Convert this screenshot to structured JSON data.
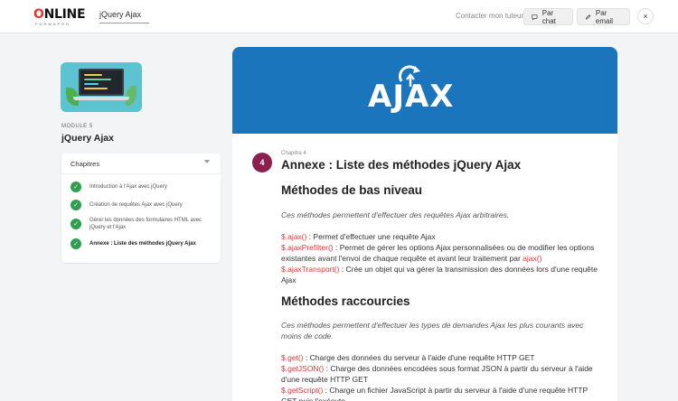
{
  "header": {
    "logo_main": "ONLINE",
    "logo_sub": "FORMAPRO",
    "search_value": "jQuery Ajax",
    "contact_label": "Contacter mon tuteur :",
    "chat_button": "Par chat",
    "email_button": "Par email",
    "close": "×"
  },
  "sidebar": {
    "module_label": "MODULE 5",
    "module_title": "jQuery Ajax",
    "chapters_label": "Chapitres",
    "chapters": [
      {
        "label": "Introduction à l'Ajax avec jQuery",
        "status": "completed"
      },
      {
        "label": "Création de requêtes Ajax avec jQuery",
        "status": "completed"
      },
      {
        "label": "Gérer les données des formulaires HTML avec jQuery et l'Ajax",
        "status": "completed"
      },
      {
        "label": "Annexe : Liste des méthodes jQuery Ajax",
        "status": "current"
      }
    ]
  },
  "content": {
    "banner_text": "AJAX",
    "chapter_number": "4",
    "chapter_label": "Chapitre 4",
    "chapter_title": "Annexe : Liste des méthodes jQuery Ajax",
    "section1": {
      "title": "Méthodes de bas niveau",
      "intro": "Ces méthodes permettent d'effectuer des requêtes Ajax arbitraires.",
      "items": [
        {
          "method": "$.ajax()",
          "text": " : Permet d'effectuer une requête Ajax"
        },
        {
          "method": "$.ajaxPrefilter()",
          "text": " : Permet de gérer les options Ajax personnalisées ou de modifier les options existantes avant l'envoi de chaque requête et avant leur traitement par ",
          "method2": "ajax()"
        },
        {
          "method": "$.ajaxTransport()",
          "text": " : Crée un objet qui va gérer la transmission des données lors d'une requête Ajax"
        }
      ]
    },
    "section2": {
      "title": "Méthodes raccourcies",
      "intro": "Ces méthodes permettent d'effectuer les types de demandes Ajax les plus courants avec moins de code.",
      "items": [
        {
          "method": "$.get()",
          "text": " : Charge des données du serveur à l'aide d'une requête HTTP GET"
        },
        {
          "method": "$.getJSON()",
          "text": " : Charge des données encodées sous format JSON à partir du serveur à l'aide d'une requête HTTP GET"
        },
        {
          "method": "$.getScript()",
          "text": " : Charge un fichier JavaScript à partir du serveur à l'aide d'une requête HTTP GET puis l'exécute"
        }
      ]
    }
  },
  "colors": {
    "accent_red": "#e53935",
    "banner_blue": "#1b75bd",
    "chapter_badge": "#8b1f4d",
    "check_green": "#2e9e4f"
  },
  "icons": {
    "chat": "chat-bubble-icon",
    "email": "pencil-icon",
    "close": "close-icon",
    "check": "check-icon",
    "chevron": "chevron-down-icon"
  }
}
